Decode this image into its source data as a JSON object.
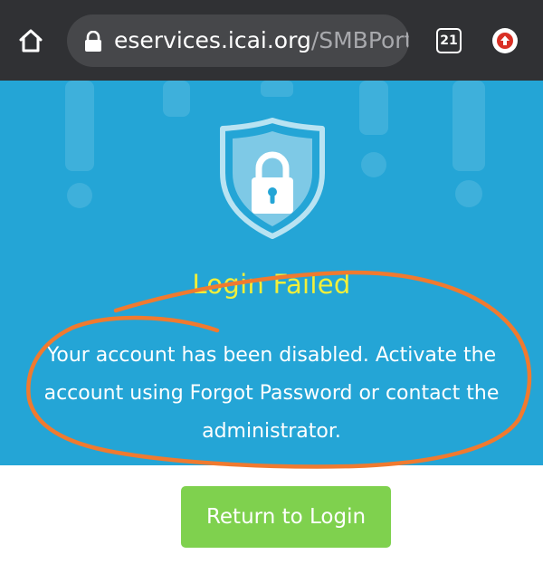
{
  "browser": {
    "url_host": "eservices.icai.org",
    "url_path": "/SMBPortal",
    "tab_count": "21",
    "icons": [
      "home-icon",
      "lock-icon",
      "tabs-icon",
      "update-icon"
    ]
  },
  "error": {
    "title": "Login Failed",
    "message": "Your account has been disabled. Activate the account using Forgot Password or contact the administrator.",
    "icons": [
      "shield-lock-icon",
      "exclamation-background"
    ]
  },
  "actions": {
    "return_label": "Return to Login"
  },
  "colors": {
    "toolbar": "#303134",
    "panel": "#24a5d6",
    "title": "#f2ef3a",
    "button": "#7fd14e",
    "annotation": "#f07a2f"
  }
}
